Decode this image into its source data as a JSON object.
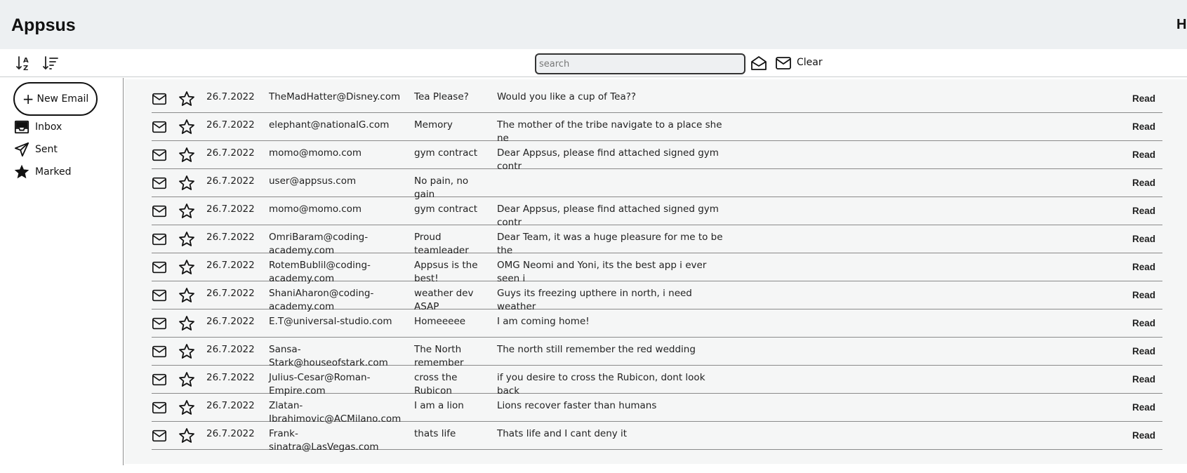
{
  "header": {
    "title": "Appsus",
    "right_text": "H"
  },
  "toolbar": {
    "search_placeholder": "search",
    "clear_label": "Clear"
  },
  "sidebar": {
    "new_email_label": "New Email",
    "items": [
      {
        "label": "Inbox",
        "icon": "inbox-icon"
      },
      {
        "label": "Sent",
        "icon": "send-icon"
      },
      {
        "label": "Marked",
        "icon": "star-filled-icon"
      }
    ]
  },
  "emails": [
    {
      "date": "26.7.2022",
      "from": "TheMadHatter@Disney.com",
      "subject": "Tea Please?",
      "body": "Would you like a cup of Tea??",
      "status": "Read"
    },
    {
      "date": "26.7.2022",
      "from": "elephant@nationalG.com",
      "subject": "Memory",
      "body": "The mother of the tribe navigate to a place she ne",
      "status": "Read"
    },
    {
      "date": "26.7.2022",
      "from": "momo@momo.com",
      "subject": "gym contract",
      "body": "Dear Appsus, please find attached signed gym contr",
      "status": "Read"
    },
    {
      "date": "26.7.2022",
      "from": "user@appsus.com",
      "subject": "No pain, no gain",
      "body": "",
      "status": "Read"
    },
    {
      "date": "26.7.2022",
      "from": "momo@momo.com",
      "subject": "gym contract",
      "body": "Dear Appsus, please find attached signed gym contr",
      "status": "Read"
    },
    {
      "date": "26.7.2022",
      "from": "OmriBaram@coding-academy.com",
      "subject": "Proud teamleader",
      "body": "Dear Team, it was a huge pleasure for me to be the",
      "status": "Read"
    },
    {
      "date": "26.7.2022",
      "from": "RotemBublil@coding-academy.com",
      "subject": "Appsus is the best!",
      "body": "OMG Neomi and Yoni, its the best app i ever seen i",
      "status": "Read"
    },
    {
      "date": "26.7.2022",
      "from": "ShaniAharon@coding-academy.com",
      "subject": "weather dev ASAP",
      "body": "Guys its freezing upthere in north, i need weather",
      "status": "Read"
    },
    {
      "date": "26.7.2022",
      "from": "E.T@universal-studio.com",
      "subject": "Homeeeee",
      "body": "I am coming home!",
      "status": "Read"
    },
    {
      "date": "26.7.2022",
      "from": "Sansa-Stark@houseofstark.com",
      "subject": "The North remember",
      "body": "The north still remember the red wedding",
      "status": "Read"
    },
    {
      "date": "26.7.2022",
      "from": "Julius-Cesar@Roman-Empire.com",
      "subject": "cross the Rubicon",
      "body": "if you desire to cross the Rubicon, dont look back",
      "status": "Read"
    },
    {
      "date": "26.7.2022",
      "from": "Zlatan-Ibrahimovic@ACMilano.com",
      "subject": "I am a lion",
      "body": "Lions recover faster than humans",
      "status": "Read"
    },
    {
      "date": "26.7.2022",
      "from": "Frank-sinatra@LasVegas.com",
      "subject": "thats life",
      "body": "Thats life and I cant deny it",
      "status": "Read"
    }
  ]
}
